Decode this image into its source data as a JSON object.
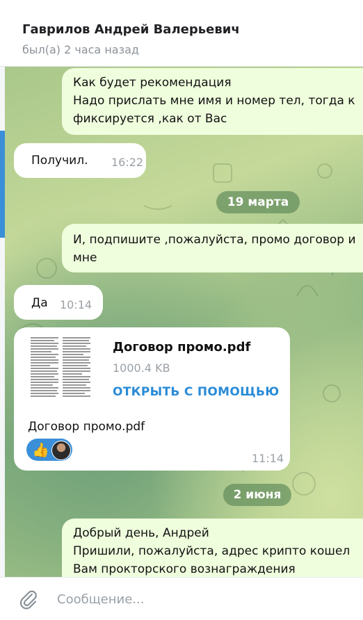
{
  "header": {
    "name": "Гаврилов Андрей Валерьевич",
    "status": "был(а) 2 часа назад"
  },
  "messages": {
    "m1": {
      "lines": [
        "Как будет рекомендация",
        "Надо прислать мне имя  и номер тел, тогда к",
        "фиксируется ,как от Вас"
      ]
    },
    "m2": {
      "text": "Получил.",
      "time": "16:22"
    },
    "date1": "19 марта",
    "m3": {
      "lines": [
        "И, подпишите ,пожалуйста, промо договор и",
        "мне"
      ]
    },
    "m4": {
      "text": "Да",
      "time": "10:14"
    },
    "m5": {
      "file_name": "Договор промо.pdf",
      "file_size": "1000.4 KB",
      "open_with": "ОТКРЫТЬ С ПОМОЩЬЮ",
      "caption": "Договор промо.pdf",
      "reaction_emoji": "👍",
      "time": "11:14"
    },
    "date2": "2 июня",
    "m6": {
      "lines": [
        "Добрый день, Андрей",
        "Пришили, пожалуйста, адрес крипто кошел",
        "Вам прокторского вознаграждения"
      ]
    }
  },
  "composer": {
    "placeholder": "Сообщение..."
  },
  "colors": {
    "outgoing_bubble": "#effedd",
    "incoming_bubble": "#ffffff",
    "accent": "#3a8fd8",
    "link": "#2a8bd6"
  },
  "icons": {
    "attach": "paperclip-icon",
    "file_preview": "document-thumbnail",
    "reaction": "thumbs-up-icon"
  }
}
